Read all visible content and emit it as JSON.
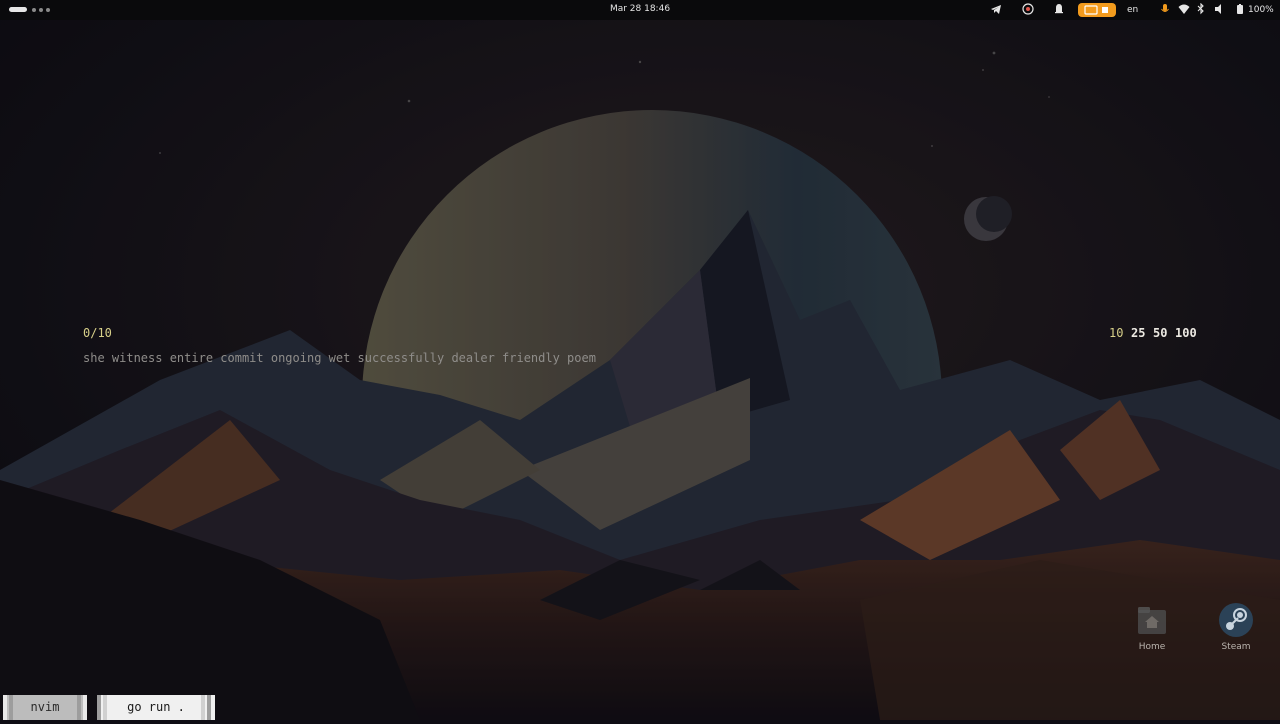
{
  "topbar": {
    "datetime": "Mar 28  18:46",
    "language": "en",
    "battery": "100%"
  },
  "typing": {
    "counter": "0/10",
    "words": "she witness entire commit ongoing wet successfully dealer friendly poem",
    "word_counts": [
      "10",
      "25",
      "50",
      "100"
    ],
    "selected_count": "10"
  },
  "desktop": {
    "icons": [
      {
        "label": "Home",
        "icon": "home-folder-icon"
      },
      {
        "label": "Steam",
        "icon": "steam-icon"
      }
    ]
  },
  "dock": {
    "items": [
      "nvim",
      "go run ."
    ]
  },
  "colors": {
    "accent_yellow": "#d8d08a",
    "tray_orange": "#f29b1d",
    "text_dim": "#8f8d8a"
  }
}
